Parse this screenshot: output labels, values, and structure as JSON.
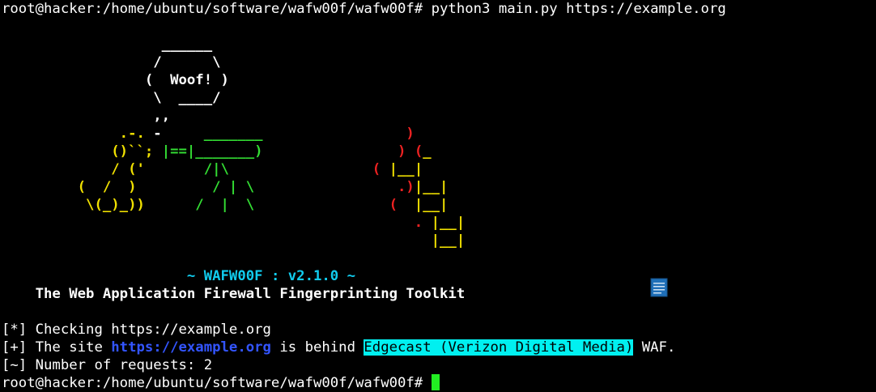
{
  "terminal": {
    "prompt": "root@hacker:/home/ubuntu/software/wafw00f/wafw00f#",
    "command": " python3 main.py https://example.org",
    "colors": {
      "background": "#000000",
      "text": "#ffffff",
      "yellow": "#f0e000",
      "green": "#33dd33",
      "red": "#ee2222",
      "cyan": "#11ccee",
      "link": "#3355ff",
      "highlight": "#00f0f0",
      "cursor": "#22ee22"
    }
  },
  "banner": {
    "bubble_top": "                   ______",
    "bubble_mid": "                  /      \\",
    "bubble_woof": "                 (  Woof! )",
    "bubble_bottom": "                  \\  ____/",
    "bubble_tail": "                  ,,",
    "a6_y": "              .-. ",
    "a6_w": "-",
    "a6_g": "     _______",
    "a6_r": "                 )",
    "a7_y": "             ()``; ",
    "a7_g": "|==|_______)",
    "a7_r": "                ) (",
    "a7_yb": "_",
    "a8_y": "             / ('",
    "a8_g": "       /|\\",
    "a8_r": "                 ( ",
    "a8_yb": "|__|",
    "a9_y": "         (  /  )",
    "a9_g": "         / | \\",
    "a9_r": "                 .)",
    "a9_yb": "|__|",
    "a10_y": "          \\(_)_))",
    "a10_g": "      /  |  \\",
    "a10_r": "                (  ",
    "a10_yb": "|__|",
    "a11_r": "                                                 . ",
    "a11_yb": "|__|",
    "a12_yb": "                                                   |__|",
    "title_pad": "                      ",
    "title": "~ WAFW00F : v2.1.0 ~",
    "subtitle": "    The Web Application Firewall Fingerprinting Toolkit"
  },
  "output": {
    "checking": "[*] Checking https://example.org",
    "result_prefix": "[+] The site ",
    "result_url": "https://example.org",
    "result_mid": " is behind ",
    "result_waf": "Edgecast (Verizon Digital Media)",
    "result_suffix": " WAF.",
    "requests": "[~] Number of requests: 2"
  },
  "icons": {
    "overlay": "document-icon"
  }
}
